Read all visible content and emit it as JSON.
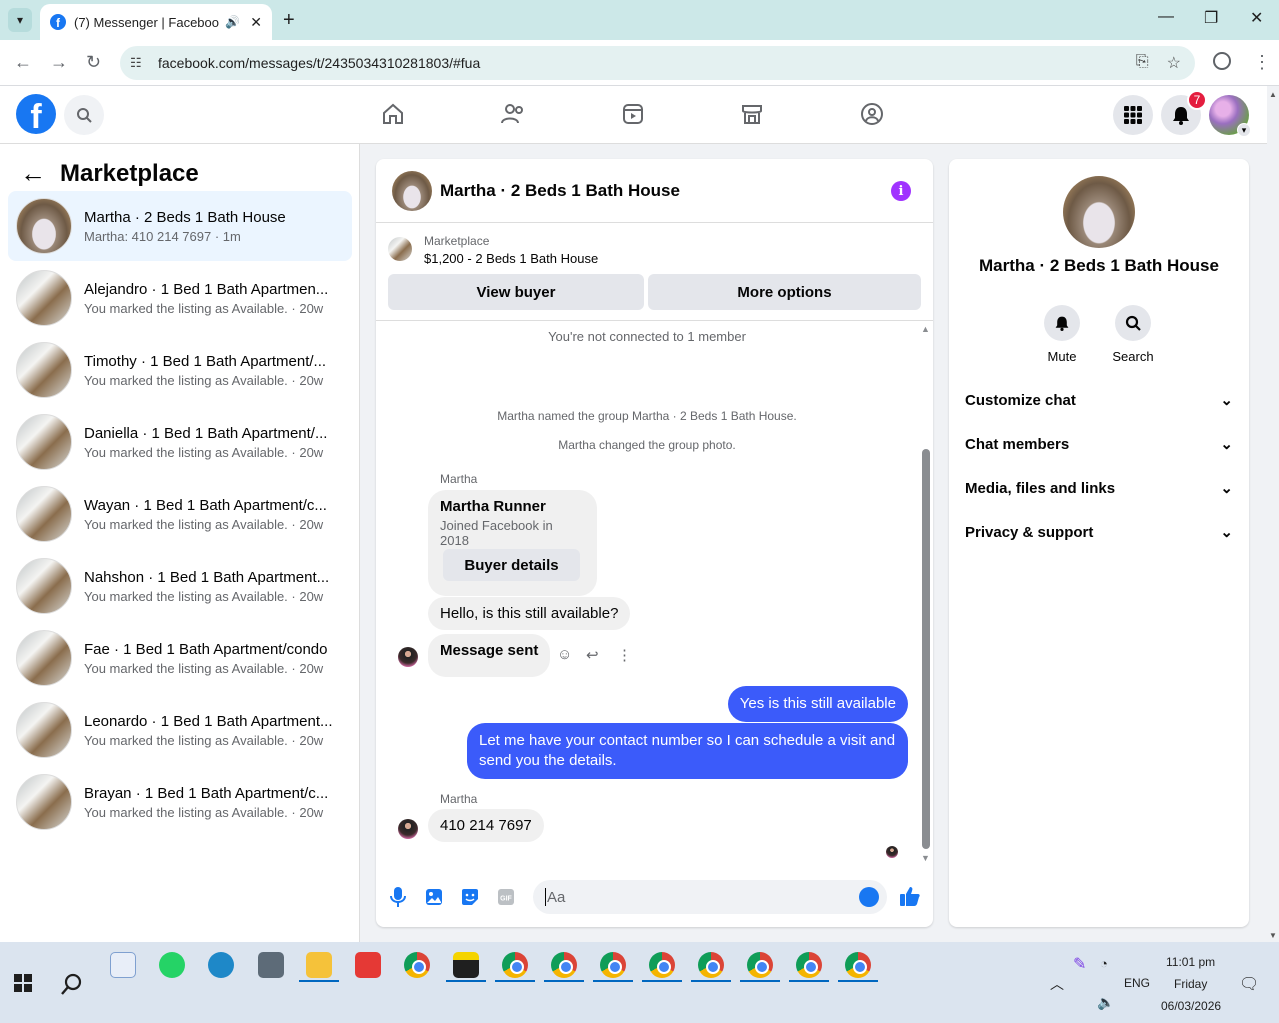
{
  "browser": {
    "tab_title": "(7) Messenger | Facebook",
    "url": "facebook.com/messages/t/2435034310281803/#fua"
  },
  "header": {
    "notif_count": "7"
  },
  "sidebar": {
    "title": "Marketplace",
    "conversations": [
      {
        "name": "Martha · 2 Beds 1 Bath House",
        "sub": "Martha: 410 214 7697 · 1m",
        "active": true
      },
      {
        "name": "Alejandro · 1 Bed 1 Bath Apartmen...",
        "sub": "You marked the listing as Available. · 20w"
      },
      {
        "name": "Timothy · 1 Bed 1 Bath Apartment/...",
        "sub": "You marked the listing as Available. · 20w"
      },
      {
        "name": "Daniella · 1 Bed 1 Bath Apartment/...",
        "sub": "You marked the listing as Available. · 20w"
      },
      {
        "name": "Wayan · 1 Bed 1 Bath Apartment/c...",
        "sub": "You marked the listing as Available. · 20w"
      },
      {
        "name": "Nahshon · 1 Bed 1 Bath Apartment...",
        "sub": "You marked the listing as Available. · 20w"
      },
      {
        "name": "Fae · 1 Bed 1 Bath Apartment/condo",
        "sub": "You marked the listing as Available. · 20w"
      },
      {
        "name": "Leonardo · 1 Bed 1 Bath Apartment...",
        "sub": "You marked the listing as Available. · 20w"
      },
      {
        "name": "Brayan · 1 Bed 1 Bath Apartment/c...",
        "sub": "You marked the listing as Available. · 20w"
      }
    ]
  },
  "chat": {
    "title": "Martha · 2 Beds 1 Bath House",
    "marketplace_label": "Marketplace",
    "listing": "$1,200 - 2 Beds 1 Bath House",
    "view_buyer": "View buyer",
    "more_options": "More options",
    "sys_connected": "You're not connected to 1 member",
    "sys_named": "Martha named the group Martha · 2 Beds 1 Bath House.",
    "sys_photo": "Martha changed the group photo.",
    "sender1": "Martha",
    "card_name": "Martha Runner",
    "card_sub": "Joined Facebook in 2018",
    "card_button": "Buyer details",
    "msg_hello": "Hello, is this still available?",
    "msg_sent": "Message sent",
    "msg_out1": "Yes is this still available",
    "msg_out2": "Let me have your contact number so I can schedule a visit and send you the details.",
    "sender2": "Martha",
    "msg_number": "410 214 7697",
    "input_placeholder": "Aa"
  },
  "rpanel": {
    "name": "Martha · 2 Beds 1 Bath House",
    "mute": "Mute",
    "search": "Search",
    "sections": [
      "Customize chat",
      "Chat members",
      "Media, files and links",
      "Privacy & support"
    ]
  },
  "taskbar": {
    "lang": "ENG",
    "time": "11:01 pm",
    "day": "Friday",
    "date": "06/03/2026"
  },
  "colors": {
    "fb_blue": "#1877f2",
    "outgoing_bubble": "#3b5bfa",
    "active_conv": "#ebf5ff"
  }
}
